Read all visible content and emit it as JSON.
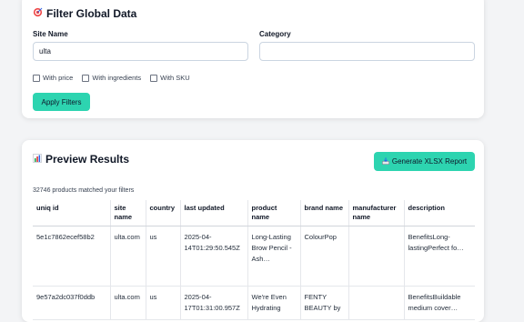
{
  "filter": {
    "icon": "target-icon",
    "title": "Filter Global Data",
    "site_label": "Site Name",
    "site_value": "ulta",
    "category_label": "Category",
    "category_value": "",
    "checkboxes": [
      {
        "label": "With price",
        "checked": false
      },
      {
        "label": "With ingredients",
        "checked": false
      },
      {
        "label": "With SKU",
        "checked": false
      }
    ],
    "apply_label": "Apply Filters"
  },
  "preview": {
    "icon": "bar-chart-icon",
    "title": "Preview Results",
    "report_icon": "download-icon",
    "report_label": "Generate XLSX Report",
    "count_text": "32746 products matched your filters",
    "columns": [
      "uniq id",
      "site name",
      "country",
      "last updated",
      "product name",
      "brand name",
      "manufacturer name",
      "description"
    ],
    "rows": [
      [
        "5e1c7862ecef58b2",
        "ulta.com",
        "us",
        "2025-04-\n14T01:29:50.545Z",
        "Long-Lasting\nBrow Pencil -\nAsh…",
        "ColourPop",
        "",
        "BenefitsLong-\nlastingPerfect fo…"
      ],
      [
        "9e57a2dc037f0ddb",
        "ulta.com",
        "us",
        "2025-04-\n17T01:31:00.957Z",
        "We're Even\nHydrating",
        "FENTY\nBEAUTY by",
        "",
        "BenefitsBuildable\nmedium cover…"
      ]
    ]
  },
  "colors": {
    "accent": "#2dd4b0",
    "background": "#f3f4f6"
  }
}
